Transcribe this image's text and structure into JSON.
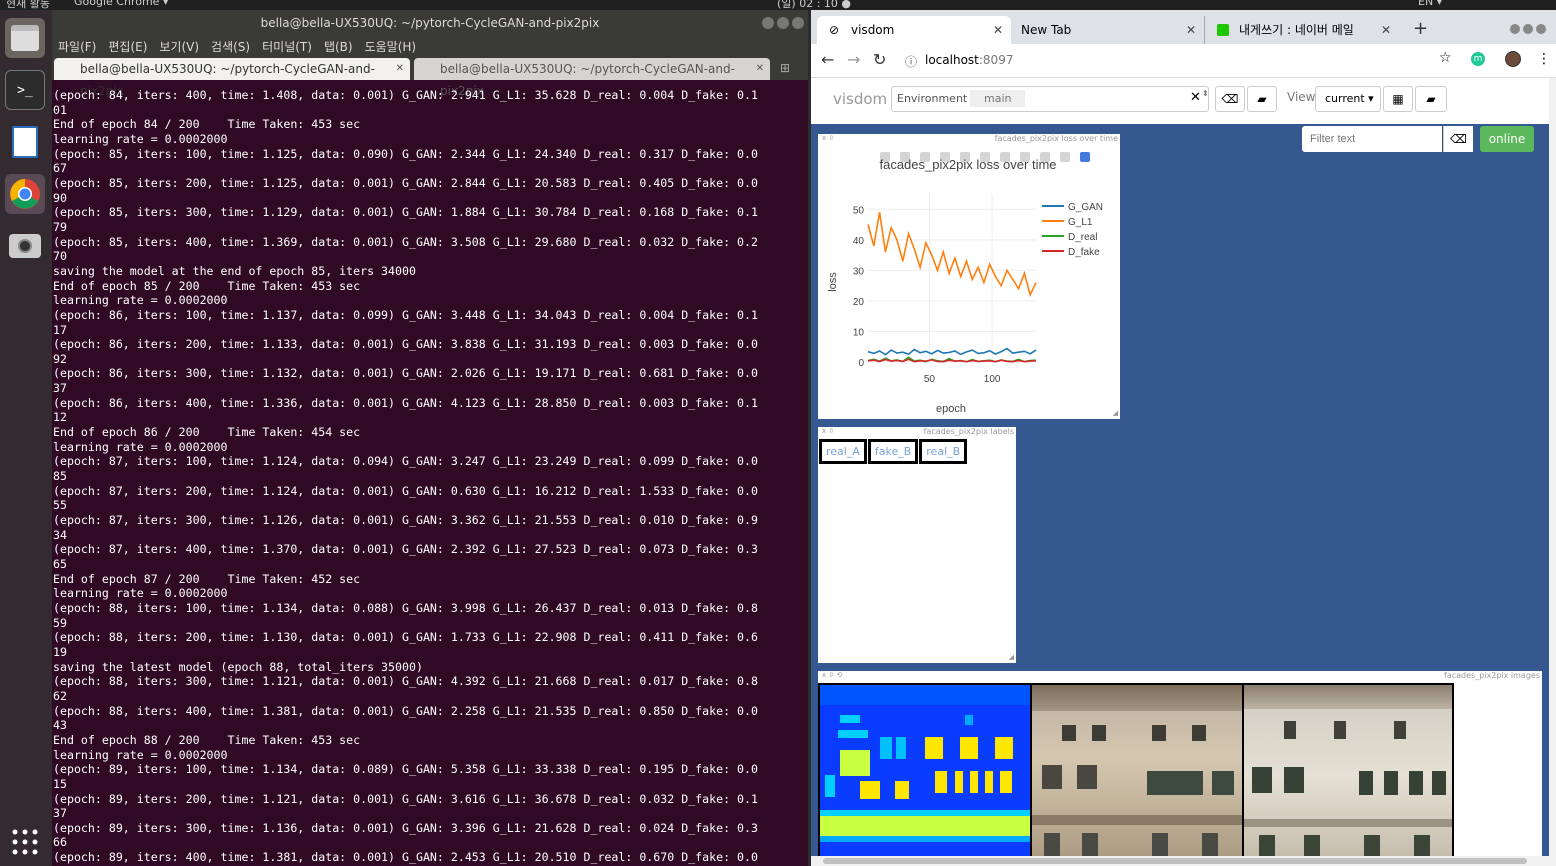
{
  "topbar": {
    "activities": "현재 활동",
    "app": "Google Chrome ▾",
    "clock": "(일) 02 : 10 ●",
    "lang": "EN ▾"
  },
  "terminal": {
    "title": "bella@bella-UX530UQ: ~/pytorch-CycleGAN-and-pix2pix",
    "menu": [
      "파일(F)",
      "편집(E)",
      "보기(V)",
      "검색(S)",
      "터미널(T)",
      "탭(B)",
      "도움말(H)"
    ],
    "tabs": [
      "bella@bella-UX530UQ: ~/pytorch-CycleGAN-and-pix2pix",
      "bella@bella-UX530UQ: ~/pytorch-CycleGAN-and-pix2pix"
    ],
    "output": "(epoch: 84, iters: 400, time: 1.408, data: 0.001) G_GAN: 2.941 G_L1: 35.628 D_real: 0.004 D_fake: 0.1\n01\nEnd of epoch 84 / 200    Time Taken: 453 sec\nlearning rate = 0.0002000\n(epoch: 85, iters: 100, time: 1.125, data: 0.090) G_GAN: 2.344 G_L1: 24.340 D_real: 0.317 D_fake: 0.0\n67\n(epoch: 85, iters: 200, time: 1.125, data: 0.001) G_GAN: 2.844 G_L1: 20.583 D_real: 0.405 D_fake: 0.0\n90\n(epoch: 85, iters: 300, time: 1.129, data: 0.001) G_GAN: 1.884 G_L1: 30.784 D_real: 0.168 D_fake: 0.1\n79\n(epoch: 85, iters: 400, time: 1.369, data: 0.001) G_GAN: 3.508 G_L1: 29.680 D_real: 0.032 D_fake: 0.2\n70\nsaving the model at the end of epoch 85, iters 34000\nEnd of epoch 85 / 200    Time Taken: 453 sec\nlearning rate = 0.0002000\n(epoch: 86, iters: 100, time: 1.137, data: 0.099) G_GAN: 3.448 G_L1: 34.043 D_real: 0.004 D_fake: 0.1\n17\n(epoch: 86, iters: 200, time: 1.133, data: 0.001) G_GAN: 3.838 G_L1: 31.193 D_real: 0.003 D_fake: 0.0\n92\n(epoch: 86, iters: 300, time: 1.132, data: 0.001) G_GAN: 2.026 G_L1: 19.171 D_real: 0.681 D_fake: 0.0\n37\n(epoch: 86, iters: 400, time: 1.336, data: 0.001) G_GAN: 4.123 G_L1: 28.850 D_real: 0.003 D_fake: 0.1\n12\nEnd of epoch 86 / 200    Time Taken: 454 sec\nlearning rate = 0.0002000\n(epoch: 87, iters: 100, time: 1.124, data: 0.094) G_GAN: 3.247 G_L1: 23.249 D_real: 0.099 D_fake: 0.0\n85\n(epoch: 87, iters: 200, time: 1.124, data: 0.001) G_GAN: 0.630 G_L1: 16.212 D_real: 1.533 D_fake: 0.0\n55\n(epoch: 87, iters: 300, time: 1.126, data: 0.001) G_GAN: 3.362 G_L1: 21.553 D_real: 0.010 D_fake: 0.9\n34\n(epoch: 87, iters: 400, time: 1.370, data: 0.001) G_GAN: 2.392 G_L1: 27.523 D_real: 0.073 D_fake: 0.3\n65\nEnd of epoch 87 / 200    Time Taken: 452 sec\nlearning rate = 0.0002000\n(epoch: 88, iters: 100, time: 1.134, data: 0.088) G_GAN: 3.998 G_L1: 26.437 D_real: 0.013 D_fake: 0.8\n59\n(epoch: 88, iters: 200, time: 1.130, data: 0.001) G_GAN: 1.733 G_L1: 22.908 D_real: 0.411 D_fake: 0.6\n19\nsaving the latest model (epoch 88, total_iters 35000)\n(epoch: 88, iters: 300, time: 1.121, data: 0.001) G_GAN: 4.392 G_L1: 21.668 D_real: 0.017 D_fake: 0.8\n62\n(epoch: 88, iters: 400, time: 1.381, data: 0.001) G_GAN: 2.258 G_L1: 21.535 D_real: 0.850 D_fake: 0.0\n43\nEnd of epoch 88 / 200    Time Taken: 453 sec\nlearning rate = 0.0002000\n(epoch: 89, iters: 100, time: 1.134, data: 0.089) G_GAN: 5.358 G_L1: 33.338 D_real: 0.195 D_fake: 0.0\n15\n(epoch: 89, iters: 200, time: 1.121, data: 0.001) G_GAN: 3.616 G_L1: 36.678 D_real: 0.032 D_fake: 0.1\n37\n(epoch: 89, iters: 300, time: 1.136, data: 0.001) G_GAN: 3.396 G_L1: 21.628 D_real: 0.024 D_fake: 0.3\n66\n(epoch: 89, iters: 400, time: 1.381, data: 0.001) G_GAN: 2.453 G_L1: 20.510 D_real: 0.670 D_fake: 0.0"
  },
  "chrome": {
    "tabs": [
      "visdom",
      "New Tab",
      "내게쓰기 : 네이버 메일"
    ],
    "url_host": "localhost",
    "url_port": ":8097"
  },
  "visdom": {
    "brand": "visdom",
    "env_label": "Environment",
    "env_value": "main",
    "view_label": "View",
    "view_value": "current",
    "filter_placeholder": "Filter text",
    "status": "online",
    "panes": {
      "loss_title": "facades_pix2pix loss over time",
      "labels_title": "facades_pix2pix labels",
      "images_title": "facades_pix2pix images"
    },
    "labels": [
      "real_A",
      "fake_B",
      "real_B"
    ]
  },
  "chart_data": {
    "type": "line",
    "title": "facades_pix2pix loss over time",
    "xlabel": "epoch",
    "ylabel": "loss",
    "xlim": [
      1,
      135
    ],
    "ylim": [
      0,
      55
    ],
    "xticks": [
      50,
      100
    ],
    "yticks": [
      0,
      10,
      20,
      30,
      40,
      50
    ],
    "legend_position": "top-right",
    "series": [
      {
        "name": "G_GAN",
        "color": "#1f77b4",
        "x_range": [
          1,
          135
        ],
        "values": [
          3.4,
          2.8,
          3.6,
          2.4,
          3.9,
          2.9,
          3.2,
          2.6,
          4.1,
          3.0,
          3.5,
          2.7,
          3.8,
          2.9,
          3.1,
          3.6,
          2.5,
          3.3,
          3.9,
          2.8,
          3.0,
          3.7,
          2.6,
          3.4,
          4.4,
          2.9,
          3.2,
          3.5,
          2.7,
          3.9
        ]
      },
      {
        "name": "G_L1",
        "color": "#ff7f0e",
        "x_range": [
          1,
          135
        ],
        "values": [
          45,
          38,
          49,
          36,
          44,
          40,
          33,
          42,
          37,
          31,
          39,
          35,
          30,
          36,
          29,
          34,
          28,
          33,
          27,
          31,
          26,
          32,
          28,
          25,
          30,
          27,
          24,
          29,
          22,
          26
        ]
      },
      {
        "name": "D_real",
        "color": "#2ca02c",
        "x_range": [
          1,
          135
        ],
        "values": [
          0.5,
          0.9,
          0.3,
          1.2,
          0.4,
          0.7,
          0.2,
          1.5,
          0.3,
          0.6,
          0.1,
          0.9,
          0.4,
          0.2,
          1.1,
          0.3,
          0.5,
          0.1,
          0.8,
          0.2,
          0.4,
          0.6,
          0.1,
          0.7,
          0.3,
          0.2,
          0.9,
          0.1,
          0.5,
          0.6
        ]
      },
      {
        "name": "D_fake",
        "color": "#d62728",
        "x_range": [
          1,
          135
        ],
        "values": [
          0.4,
          0.6,
          0.2,
          0.8,
          0.3,
          0.5,
          0.2,
          0.9,
          0.1,
          0.4,
          0.3,
          0.7,
          0.2,
          0.1,
          0.6,
          0.3,
          0.4,
          0.1,
          0.5,
          0.2,
          0.3,
          0.4,
          0.1,
          0.6,
          0.2,
          0.1,
          0.5,
          0.1,
          0.3,
          0.4
        ]
      }
    ]
  },
  "colors": {
    "terminal_bg": "#300a24",
    "visdom_bg": "#34588f",
    "online_green": "#5cb85c"
  }
}
